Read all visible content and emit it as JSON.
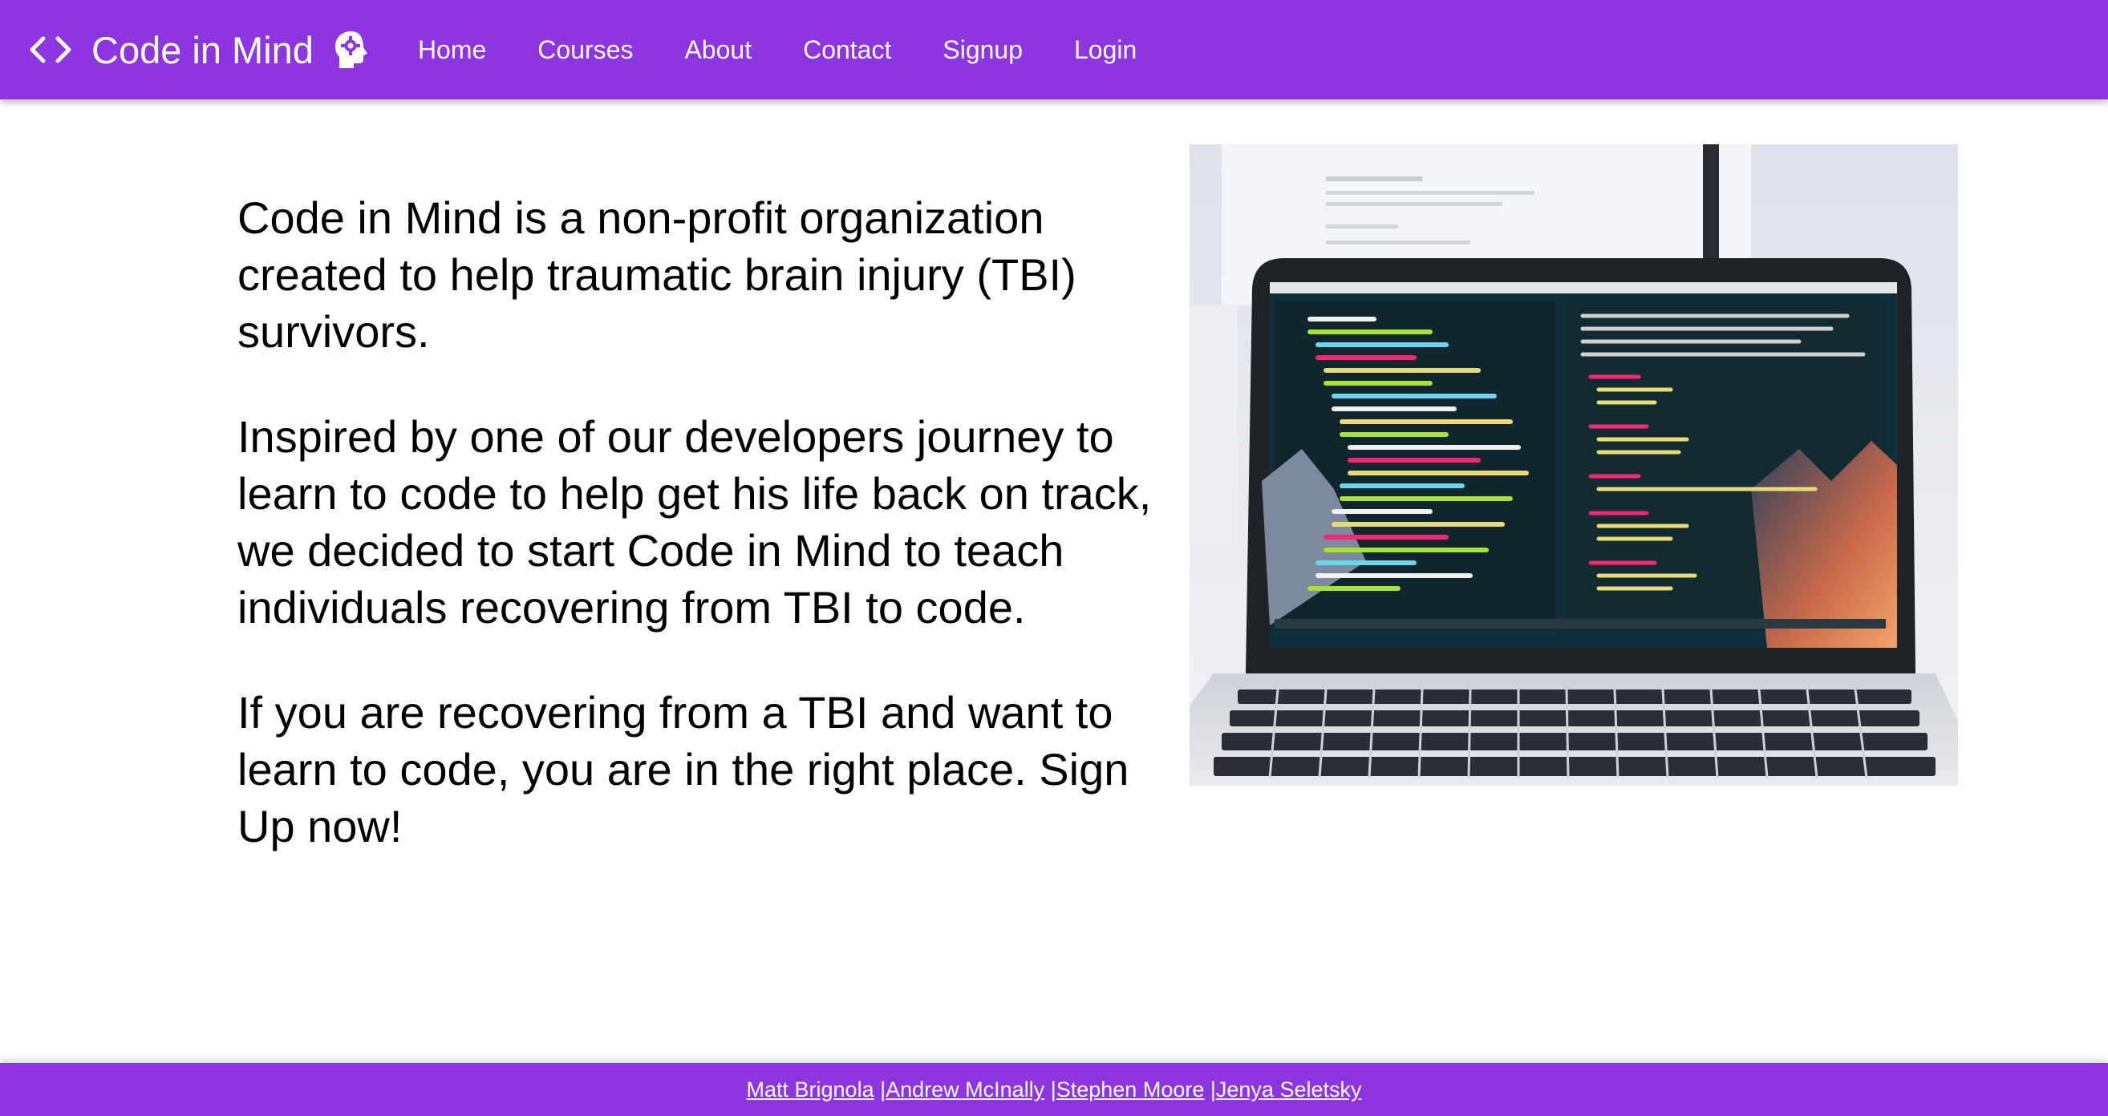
{
  "brand": {
    "title": "Code in Mind",
    "code_icon": "code-brackets-icon",
    "head_icon": "head-gear-icon"
  },
  "nav": {
    "items": [
      {
        "label": "Home"
      },
      {
        "label": "Courses"
      },
      {
        "label": "About"
      },
      {
        "label": "Contact"
      },
      {
        "label": "Signup"
      },
      {
        "label": "Login"
      }
    ]
  },
  "main": {
    "paragraphs": [
      "Code in Mind is a non-profit organization created to help traumatic brain injury (TBI) survivors.",
      "Inspired by one of our developers journey to learn to code to help get his life back on track, we decided to start Code in Mind to teach individuals recovering from TBI to code.",
      "If you are recovering from a TBI and want to learn to code, you are in the right place. Sign Up now!"
    ]
  },
  "footer": {
    "separator": "|",
    "credits": [
      "Matt Brignola",
      "Andrew McInally",
      "Stephen Moore",
      "Jenya Seletsky"
    ]
  },
  "colors": {
    "primary": "#8c35e0",
    "text": "#000000",
    "background": "#ffffff"
  }
}
